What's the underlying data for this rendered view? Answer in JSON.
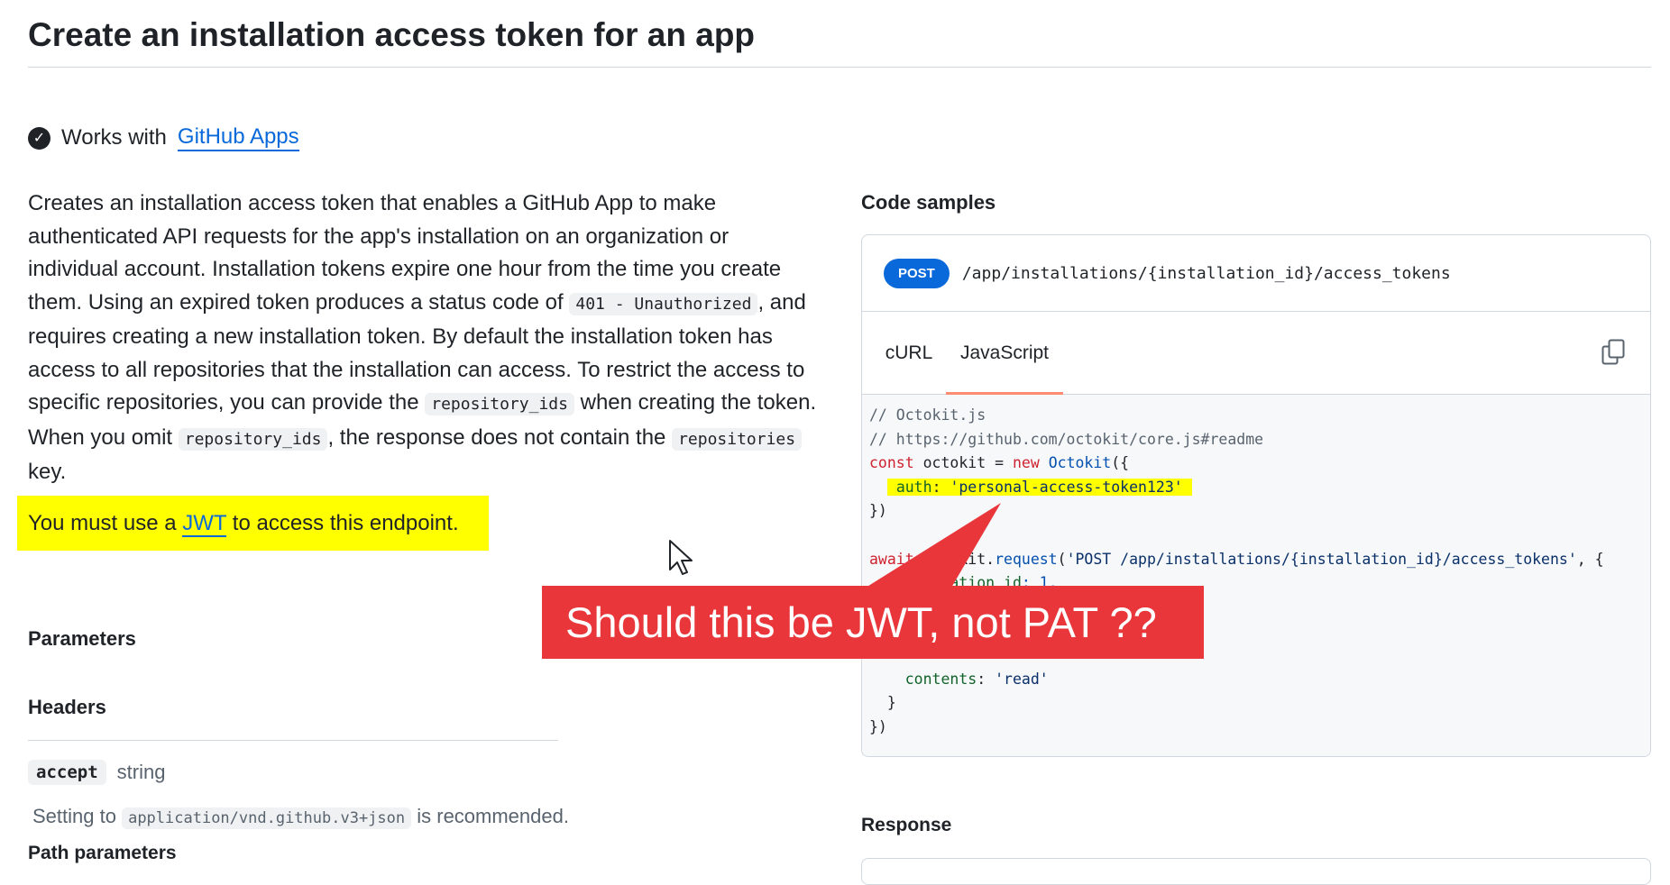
{
  "page": {
    "title": "Create an installation access token for an app",
    "works_with_prefix": "Works with",
    "works_with_link": "GitHub Apps"
  },
  "description": {
    "p1": "Creates an installation access token that enables a GitHub App to make authenticated API requests for the app's installation on an organization or individual account. Installation tokens expire one hour from the time you create them. Using an expired token produces a status code of ",
    "code1": "401 - Unauthorized",
    "p2": ", and requires creating a new installation token. By default the installation token has access to all repositories that the installation can access. To restrict the access to specific repositories, you can provide the ",
    "code2": "repository_ids",
    "p3": " when creating the token. When you omit ",
    "code3": "repository_ids",
    "p4": ", the response does not contain the ",
    "code4": "repositories",
    "p5": " key."
  },
  "jwt_note": {
    "prefix": "You must use a ",
    "link": "JWT",
    "suffix": " to access this endpoint."
  },
  "parameters": {
    "heading": "Parameters",
    "headers_heading": "Headers",
    "accept_name": "accept",
    "accept_type": "string",
    "accept_desc_prefix": "Setting to ",
    "accept_desc_code": "application/vnd.github.v3+json",
    "accept_desc_suffix": " is recommended.",
    "path_heading": "Path parameters"
  },
  "code_samples": {
    "heading": "Code samples",
    "method": "POST",
    "endpoint": "/app/installations/{installation_id}/access_tokens",
    "tabs": [
      "cURL",
      "JavaScript"
    ],
    "active_tab": "JavaScript",
    "lines": {
      "l1": "// Octokit.js",
      "l2": "// https://github.com/octokit/core.js#readme",
      "l3_kw": "const",
      "l3_mid": " octokit = ",
      "l3_new": "new",
      "l3_cls": " Octokit",
      "l3_end": "({",
      "l4": "auth: 'personal-access-token123'",
      "l5": "})",
      "l7_kw": "await",
      "l7_obj": " octokit.",
      "l7_fn": "request",
      "l7_open": "(",
      "l7_str": "'POST /app/installations/{installation_id}/access_tokens'",
      "l7_end": ", {",
      "l8_prop": "  installation_id",
      "l8_val": ": 1,",
      "l12_prop": "    contents",
      "l12_mid": ": ",
      "l12_str": "'read'",
      "l13": "  }",
      "l14": "})"
    }
  },
  "response": {
    "heading": "Response"
  },
  "annotation": {
    "text": "Should this be JWT, not PAT ??",
    "color": "#e8363a"
  },
  "colors": {
    "link": "#0969da",
    "highlight": "#ffff00",
    "badge": "#0969da",
    "tab_underline": "#fd8c73"
  }
}
